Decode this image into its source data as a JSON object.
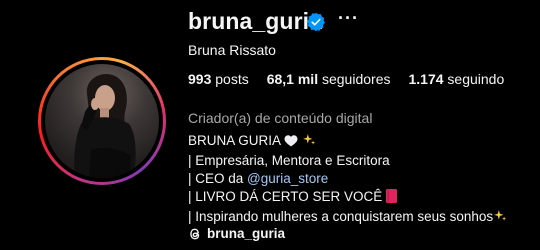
{
  "profile": {
    "username": "bruna_guria",
    "full_name": "Bruna Rissato",
    "verified": true,
    "more_label": "···"
  },
  "stats": {
    "posts_count": "993",
    "posts_label": "posts",
    "followers_count": "68,1 mil",
    "followers_label": "seguidores",
    "following_count": "1.174",
    "following_label": "seguindo"
  },
  "category": "Criador(a) de conteúdo digital",
  "bio": {
    "line1": "BRUNA GURIA",
    "line2": "| Empresária, Mentora e Escritora",
    "line3_prefix": "| CEO da ",
    "line3_mention": "@guria_store",
    "line4": "| LIVRO DÁ CERTO SER VOCÊ",
    "line5": "| Inspirando mulheres a conquistarem seus sonhos"
  },
  "threads": {
    "handle": "bruna_guria"
  },
  "colors": {
    "background": "#000000",
    "text": "#f5f5f5",
    "muted": "#a8a8a8",
    "verified": "#0095f6",
    "mention": "#a3c8f5"
  }
}
